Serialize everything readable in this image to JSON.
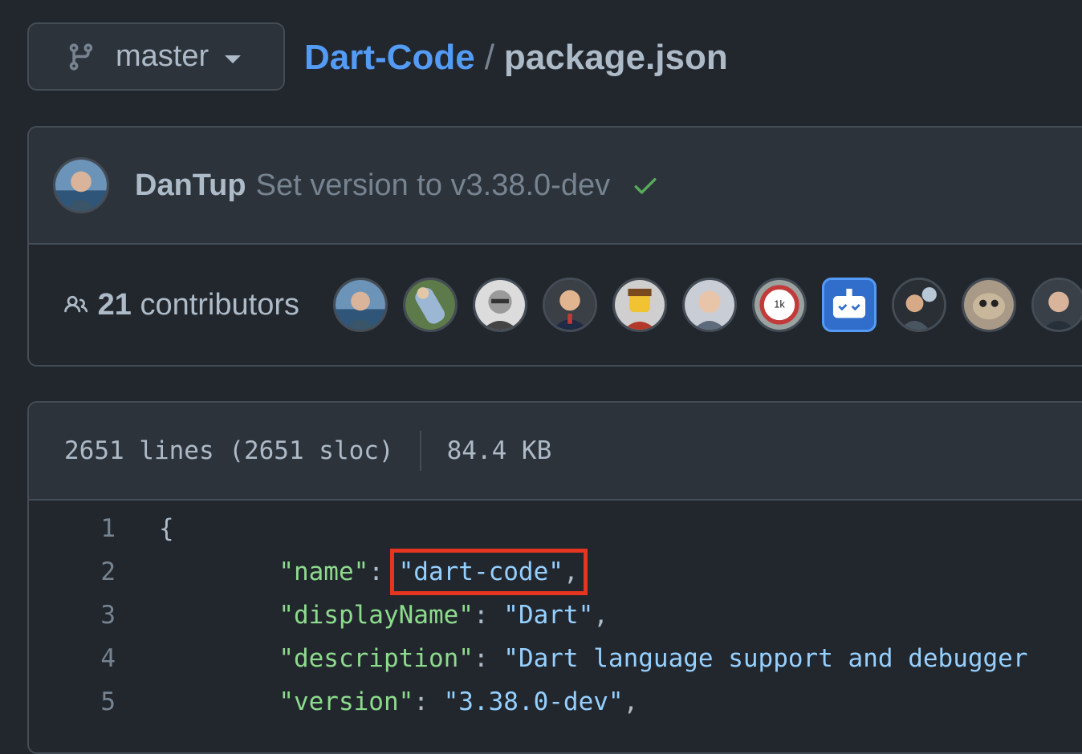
{
  "branch": {
    "name": "master"
  },
  "breadcrumb": {
    "repo": "Dart-Code",
    "separator": "/",
    "file": "package.json"
  },
  "commit": {
    "author": "DanTup",
    "message": "Set version to v3.38.0-dev",
    "status": "success-check-icon"
  },
  "contributors": {
    "count": "21",
    "label": "contributors"
  },
  "file_info": {
    "lines": "2651 lines (2651 sloc)",
    "size": "84.4 KB"
  },
  "code_lines": [
    {
      "num": "1",
      "key": "",
      "value": "",
      "text": "{"
    },
    {
      "num": "2",
      "key": "\"name\"",
      "colon": ": ",
      "value": "\"dart-code\"",
      "tail": ","
    },
    {
      "num": "3",
      "key": "\"displayName\"",
      "colon": ": ",
      "value": "\"Dart\"",
      "tail": ","
    },
    {
      "num": "4",
      "key": "\"description\"",
      "colon": ": ",
      "value": "\"Dart language support and debugger",
      "tail": ""
    },
    {
      "num": "5",
      "key": "\"version\"",
      "colon": ": ",
      "value": "\"3.38.0-dev\"",
      "tail": ","
    }
  ],
  "colors": {
    "background": "#22272e",
    "panel": "#2d333b",
    "border": "#444c56",
    "link": "#539bf5",
    "json_key": "#8ddb8c",
    "json_string": "#96d0ff",
    "highlight": "#e5341f",
    "check": "#57ab5a"
  }
}
